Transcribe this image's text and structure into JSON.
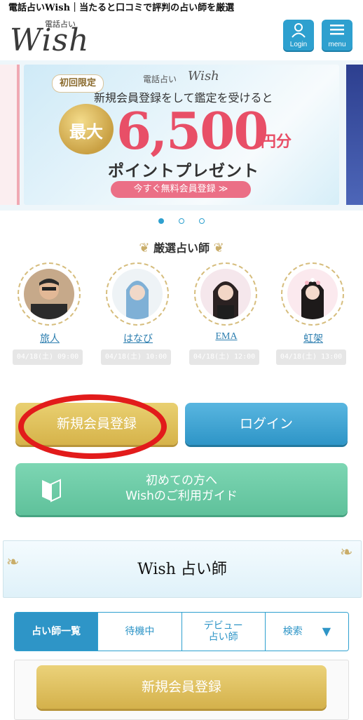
{
  "page_title": "電話占いWish｜当たると口コミで評判の占い師を厳選",
  "header": {
    "logo_small": "電話占い",
    "logo_main": "Wish",
    "login_label": "Login",
    "menu_label": "menu"
  },
  "banner": {
    "badge": "初回限定",
    "brand_small": "電話占い",
    "brand_script": "Wish",
    "subtitle": "新規会員登録をして鑑定を受けると",
    "seal": "最大",
    "amount": "6,500",
    "unit": "円分",
    "present": "ポイントプレゼント",
    "cta": "今すぐ無料会員登録 ≫",
    "slides": 3,
    "active_slide": 1
  },
  "featured": {
    "title": "厳選占い師",
    "tellers": [
      {
        "name": "旅人",
        "date": "04/18(土) 09:00"
      },
      {
        "name": "はなび",
        "date": "04/18(土) 10:00"
      },
      {
        "name": "EMA",
        "date": "04/18(土) 12:00"
      },
      {
        "name": "虹架",
        "date": "04/18(土) 13:00"
      }
    ]
  },
  "actions": {
    "register": "新規会員登録",
    "login": "ログイン",
    "guide_line1": "初めての方へ",
    "guide_line2": "Wishのご利用ガイド"
  },
  "section": {
    "title": "Wish 占い師"
  },
  "tabs": [
    {
      "line1": "占い師一覧",
      "line2": ""
    },
    {
      "line1": "待機中",
      "line2": ""
    },
    {
      "line1": "デビュー",
      "line2": "占い師"
    },
    {
      "line1": "検索",
      "line2": ""
    }
  ],
  "sticky": {
    "register": "新規会員登録"
  },
  "colors": {
    "primary_blue": "#2e95c7",
    "gold": "#d6b34a",
    "green": "#5fc19b",
    "pink": "#e84f67",
    "annotation_red": "#e21b1b"
  }
}
